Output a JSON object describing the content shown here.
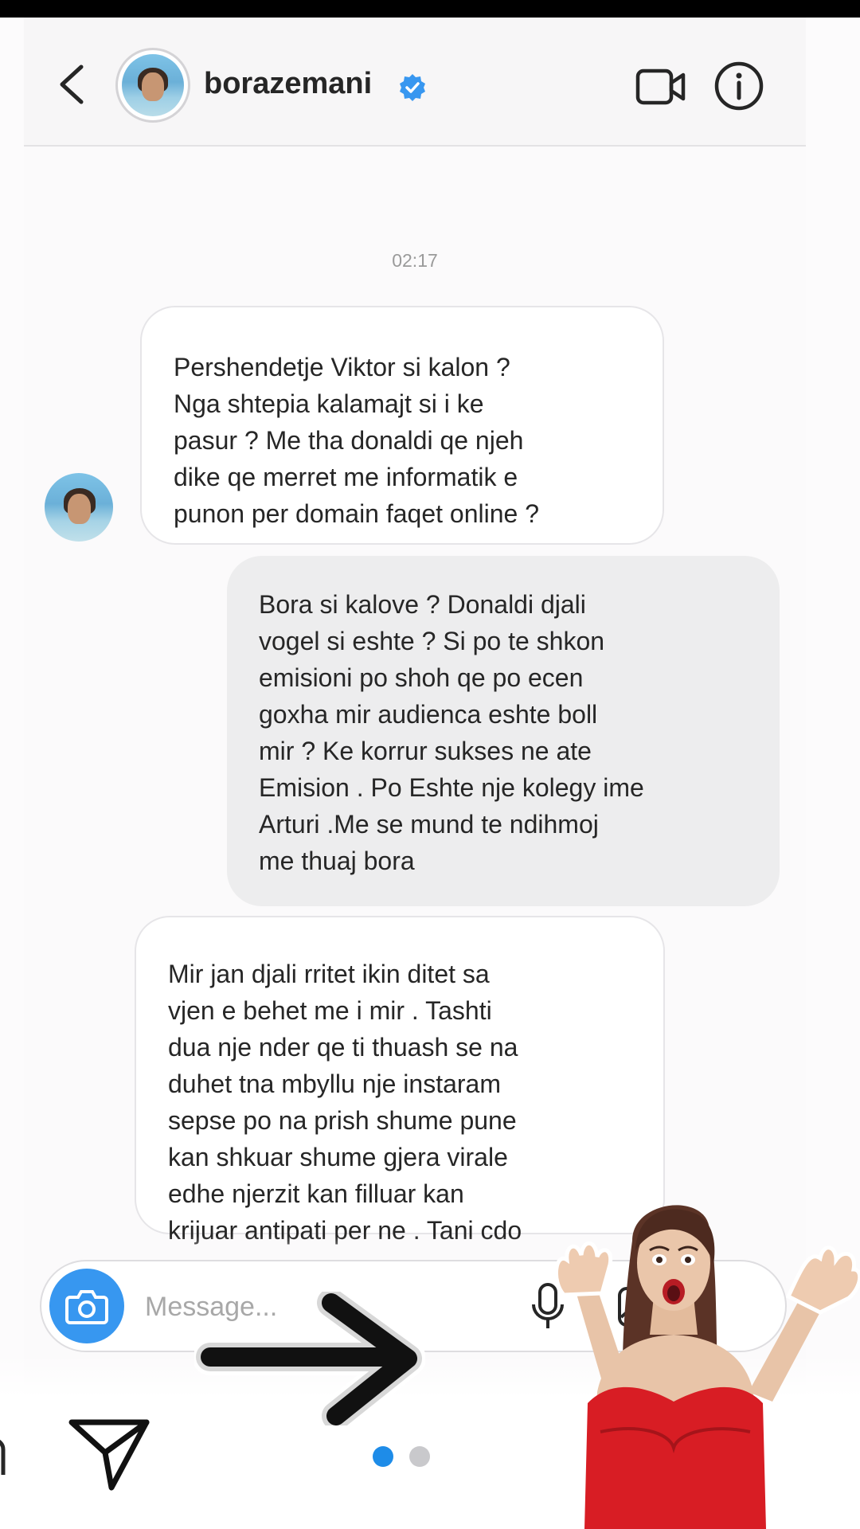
{
  "header": {
    "username": "borazemani",
    "verified": true
  },
  "thread": {
    "timestamp": "02:17",
    "messages": [
      {
        "direction": "received",
        "text": "Pershendetje Viktor si kalon ?\nNga shtepia kalamajt si i ke\npasur ? Me tha donaldi qe njeh\ndike qe merret me informatik e\npunon per domain faqet online ?"
      },
      {
        "direction": "sent",
        "text": "Bora si kalove ? Donaldi djali\nvogel si eshte ? Si po te shkon\nemisioni po shoh qe po ecen\ngoxha mir audienca eshte boll\nmir ? Ke korrur sukses ne ate\nEmision . Po Eshte nje kolegy ime\nArturi .Me se mund te ndihmoj\nme thuaj bora"
      },
      {
        "direction": "received",
        "text": "Mir jan djali rritet ikin ditet sa\nvjen e behet me i mir . Tashti\ndua nje nder qe ti thuash se na\nduhet tna mbyllu nje instaram\nsepse po na prish shume pune\nkan shkuar shume gjera virale\nedhe njerzit kan filluar kan\nkrijuar antipati per ne . Tani cdo"
      }
    ]
  },
  "composer": {
    "placeholder": "Message..."
  },
  "icons": {
    "back": "chevron-left-icon",
    "verified": "verified-badge-icon",
    "video": "video-camera-icon",
    "info": "info-icon",
    "camera": "camera-icon",
    "mic": "microphone-icon",
    "gallery": "gallery-icon",
    "share": "paper-plane-icon"
  },
  "story": {
    "pages": 2,
    "current_page": 1
  },
  "colors": {
    "accent": "#3797f0",
    "verified": "#3897f0",
    "active_dot": "#1e8ce8",
    "sent_bubble": "#ededee",
    "received_bubble": "#ffffff"
  }
}
